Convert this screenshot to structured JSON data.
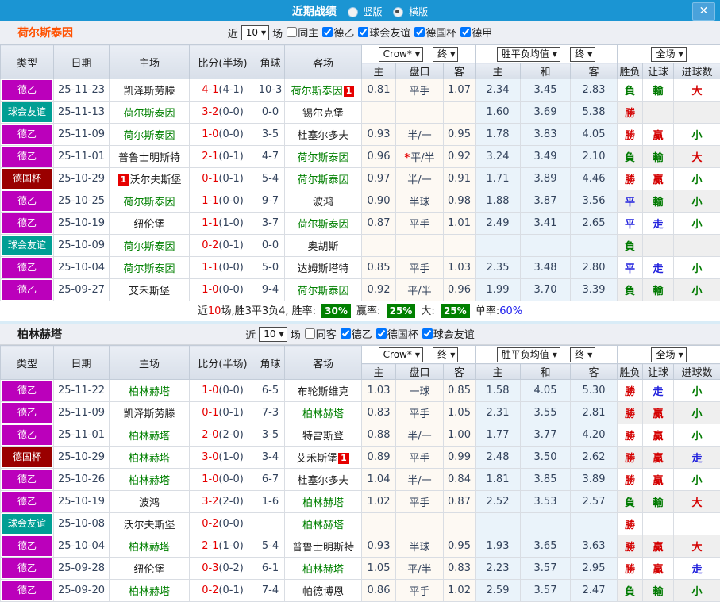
{
  "titlebar": {
    "title": "近期战绩",
    "radios": [
      {
        "label": "竖版",
        "selected": false
      },
      {
        "label": "横版",
        "selected": true
      }
    ],
    "close": "✕"
  },
  "icons": {
    "caret": "▼"
  },
  "colors": {
    "title_bar": "#1b95d3",
    "subject_team": "#008000",
    "league": {
      "德乙": "#bb00bb",
      "球会友谊": "#009e94",
      "德国杯": "#9a0000"
    },
    "result": {
      "勝": "#d40000",
      "負": "#007a00",
      "平": "#2222dd",
      "贏": "#d40000",
      "輸": "#007a00",
      "走": "#2222dd",
      "大": "#d40000",
      "小": "#007a00"
    }
  },
  "table_header": {
    "left_cols": [
      "类型",
      "日期",
      "主场",
      "比分(半场)",
      "角球",
      "客场"
    ],
    "crow_select": "Crow*",
    "final_select": "终",
    "avg_select": "胜平负均值",
    "final_select2": "终",
    "scope_select": "全场",
    "sub_cols": [
      "主",
      "盘口",
      "客",
      "主",
      "和",
      "客",
      "胜负",
      "让球",
      "进球数"
    ]
  },
  "sections": [
    {
      "team": "荷尔斯泰因",
      "team_color": "#ff5100",
      "filters": {
        "near": "近",
        "count": "10",
        "unit": "场",
        "items": [
          {
            "label": "同主",
            "checked": false
          },
          {
            "label": "德乙",
            "checked": true
          },
          {
            "label": "球会友谊",
            "checked": true
          },
          {
            "label": "德国杯",
            "checked": true
          },
          {
            "label": "德甲",
            "checked": true
          }
        ]
      },
      "rows": [
        {
          "league": "德乙",
          "date": "25-11-23",
          "home": {
            "name": "凯泽斯劳滕"
          },
          "score": "4-1",
          "half": "(4-1)",
          "corners": "10-3",
          "away": {
            "name": "荷尔斯泰因",
            "subject": true,
            "badge": "1",
            "badge_pos": "after"
          },
          "crow": [
            "0.81",
            "平手",
            "1.07"
          ],
          "crow_star": false,
          "avg": [
            "2.34",
            "3.45",
            "2.83"
          ],
          "res": [
            "負",
            "輸",
            "大"
          ]
        },
        {
          "league": "球会友谊",
          "date": "25-11-13",
          "home": {
            "name": "荷尔斯泰因",
            "subject": true
          },
          "score": "3-2",
          "half": "(0-0)",
          "corners": "0-0",
          "away": {
            "name": "锡尔克堡"
          },
          "crow": [
            "",
            "",
            ""
          ],
          "crow_star": false,
          "avg": [
            "1.60",
            "3.69",
            "5.38"
          ],
          "res": [
            "勝",
            "",
            ""
          ]
        },
        {
          "league": "德乙",
          "date": "25-11-09",
          "home": {
            "name": "荷尔斯泰因",
            "subject": true
          },
          "score": "1-0",
          "half": "(0-0)",
          "corners": "3-5",
          "away": {
            "name": "杜塞尔多夫"
          },
          "crow": [
            "0.93",
            "半/一",
            "0.95"
          ],
          "crow_star": false,
          "avg": [
            "1.78",
            "3.83",
            "4.05"
          ],
          "res": [
            "勝",
            "贏",
            "小"
          ]
        },
        {
          "league": "德乙",
          "date": "25-11-01",
          "home": {
            "name": "普鲁士明斯特"
          },
          "score": "2-1",
          "half": "(0-1)",
          "corners": "4-7",
          "away": {
            "name": "荷尔斯泰因",
            "subject": true
          },
          "crow": [
            "0.96",
            "平/半",
            "0.92"
          ],
          "crow_star": true,
          "avg": [
            "3.24",
            "3.49",
            "2.10"
          ],
          "res": [
            "負",
            "輸",
            "大"
          ]
        },
        {
          "league": "德国杯",
          "date": "25-10-29",
          "home": {
            "name": "沃尔夫斯堡",
            "badge": "1",
            "badge_pos": "before"
          },
          "score": "0-1",
          "half": "(0-1)",
          "corners": "5-4",
          "away": {
            "name": "荷尔斯泰因",
            "subject": true
          },
          "crow": [
            "0.97",
            "半/一",
            "0.91"
          ],
          "crow_star": false,
          "avg": [
            "1.71",
            "3.89",
            "4.46"
          ],
          "res": [
            "勝",
            "贏",
            "小"
          ]
        },
        {
          "league": "德乙",
          "date": "25-10-25",
          "home": {
            "name": "荷尔斯泰因",
            "subject": true
          },
          "score": "1-1",
          "half": "(0-0)",
          "corners": "9-7",
          "away": {
            "name": "波鸿"
          },
          "crow": [
            "0.90",
            "半球",
            "0.98"
          ],
          "crow_star": false,
          "avg": [
            "1.88",
            "3.87",
            "3.56"
          ],
          "res": [
            "平",
            "輸",
            "小"
          ]
        },
        {
          "league": "德乙",
          "date": "25-10-19",
          "home": {
            "name": "纽伦堡"
          },
          "score": "1-1",
          "half": "(1-0)",
          "corners": "3-7",
          "away": {
            "name": "荷尔斯泰因",
            "subject": true
          },
          "crow": [
            "0.87",
            "平手",
            "1.01"
          ],
          "crow_star": false,
          "avg": [
            "2.49",
            "3.41",
            "2.65"
          ],
          "res": [
            "平",
            "走",
            "小"
          ]
        },
        {
          "league": "球会友谊",
          "date": "25-10-09",
          "home": {
            "name": "荷尔斯泰因",
            "subject": true
          },
          "score": "0-2",
          "half": "(0-1)",
          "corners": "0-0",
          "away": {
            "name": "奥胡斯"
          },
          "crow": [
            "",
            "",
            ""
          ],
          "crow_star": false,
          "avg": [
            "",
            "",
            ""
          ],
          "res": [
            "負",
            "",
            ""
          ]
        },
        {
          "league": "德乙",
          "date": "25-10-04",
          "home": {
            "name": "荷尔斯泰因",
            "subject": true
          },
          "score": "1-1",
          "half": "(0-0)",
          "corners": "5-0",
          "away": {
            "name": "达姆斯塔特"
          },
          "crow": [
            "0.85",
            "平手",
            "1.03"
          ],
          "crow_star": false,
          "avg": [
            "2.35",
            "3.48",
            "2.80"
          ],
          "res": [
            "平",
            "走",
            "小"
          ]
        },
        {
          "league": "德乙",
          "date": "25-09-27",
          "home": {
            "name": "艾禾斯堡"
          },
          "score": "1-0",
          "half": "(0-0)",
          "corners": "9-4",
          "away": {
            "name": "荷尔斯泰因",
            "subject": true
          },
          "crow": [
            "0.92",
            "平/半",
            "0.96"
          ],
          "crow_star": false,
          "avg": [
            "1.99",
            "3.70",
            "3.39"
          ],
          "res": [
            "負",
            "輸",
            "小"
          ]
        }
      ],
      "summary": {
        "near": "近",
        "count": "10",
        "text": "场,胜3平3负4, 胜率: ",
        "win_rate": "30%",
        "mid1": " 赢率: ",
        "handicap_rate": "25%",
        "mid2": " 大: ",
        "big_rate": "25%",
        "mid3": " 单率:",
        "single_rate": "60%"
      }
    },
    {
      "team": "柏林赫塔",
      "team_color": "#1a1a1a",
      "filters": {
        "near": "近",
        "count": "10",
        "unit": "场",
        "items": [
          {
            "label": "同客",
            "checked": false
          },
          {
            "label": "德乙",
            "checked": true
          },
          {
            "label": "德国杯",
            "checked": true
          },
          {
            "label": "球会友谊",
            "checked": true
          }
        ]
      },
      "rows": [
        {
          "league": "德乙",
          "date": "25-11-22",
          "home": {
            "name": "柏林赫塔",
            "subject": true
          },
          "score": "1-0",
          "half": "(0-0)",
          "corners": "6-5",
          "away": {
            "name": "布轮斯维克"
          },
          "crow": [
            "1.03",
            "一球",
            "0.85"
          ],
          "crow_star": false,
          "avg": [
            "1.58",
            "4.05",
            "5.30"
          ],
          "res": [
            "勝",
            "走",
            "小"
          ]
        },
        {
          "league": "德乙",
          "date": "25-11-09",
          "home": {
            "name": "凯泽斯劳滕"
          },
          "score": "0-1",
          "half": "(0-1)",
          "corners": "7-3",
          "away": {
            "name": "柏林赫塔",
            "subject": true
          },
          "crow": [
            "0.83",
            "平手",
            "1.05"
          ],
          "crow_star": false,
          "avg": [
            "2.31",
            "3.55",
            "2.81"
          ],
          "res": [
            "勝",
            "贏",
            "小"
          ]
        },
        {
          "league": "德乙",
          "date": "25-11-01",
          "home": {
            "name": "柏林赫塔",
            "subject": true
          },
          "score": "2-0",
          "half": "(2-0)",
          "corners": "3-5",
          "away": {
            "name": "特雷斯登"
          },
          "crow": [
            "0.88",
            "半/一",
            "1.00"
          ],
          "crow_star": false,
          "avg": [
            "1.77",
            "3.77",
            "4.20"
          ],
          "res": [
            "勝",
            "贏",
            "小"
          ]
        },
        {
          "league": "德国杯",
          "date": "25-10-29",
          "home": {
            "name": "柏林赫塔",
            "subject": true
          },
          "score": "3-0",
          "half": "(1-0)",
          "corners": "3-4",
          "away": {
            "name": "艾禾斯堡",
            "badge": "1",
            "badge_pos": "after"
          },
          "crow": [
            "0.89",
            "平手",
            "0.99"
          ],
          "crow_star": false,
          "avg": [
            "2.48",
            "3.50",
            "2.62"
          ],
          "res": [
            "勝",
            "贏",
            "走"
          ]
        },
        {
          "league": "德乙",
          "date": "25-10-26",
          "home": {
            "name": "柏林赫塔",
            "subject": true
          },
          "score": "1-0",
          "half": "(0-0)",
          "corners": "6-7",
          "away": {
            "name": "杜塞尔多夫"
          },
          "crow": [
            "1.04",
            "半/一",
            "0.84"
          ],
          "crow_star": false,
          "avg": [
            "1.81",
            "3.85",
            "3.89"
          ],
          "res": [
            "勝",
            "贏",
            "小"
          ]
        },
        {
          "league": "德乙",
          "date": "25-10-19",
          "home": {
            "name": "波鸿"
          },
          "score": "3-2",
          "half": "(2-0)",
          "corners": "1-6",
          "away": {
            "name": "柏林赫塔",
            "subject": true
          },
          "crow": [
            "1.02",
            "平手",
            "0.87"
          ],
          "crow_star": false,
          "avg": [
            "2.52",
            "3.53",
            "2.57"
          ],
          "res": [
            "負",
            "輸",
            "大"
          ]
        },
        {
          "league": "球会友谊",
          "date": "25-10-08",
          "home": {
            "name": "沃尔夫斯堡"
          },
          "score": "0-2",
          "half": "(0-0)",
          "corners": "",
          "away": {
            "name": "柏林赫塔",
            "subject": true
          },
          "crow": [
            "",
            "",
            ""
          ],
          "crow_star": false,
          "avg": [
            "",
            "",
            ""
          ],
          "res": [
            "勝",
            "",
            ""
          ]
        },
        {
          "league": "德乙",
          "date": "25-10-04",
          "home": {
            "name": "柏林赫塔",
            "subject": true
          },
          "score": "2-1",
          "half": "(1-0)",
          "corners": "5-4",
          "away": {
            "name": "普鲁士明斯特"
          },
          "crow": [
            "0.93",
            "半球",
            "0.95"
          ],
          "crow_star": false,
          "avg": [
            "1.93",
            "3.65",
            "3.63"
          ],
          "res": [
            "勝",
            "贏",
            "大"
          ]
        },
        {
          "league": "德乙",
          "date": "25-09-28",
          "home": {
            "name": "纽伦堡"
          },
          "score": "0-3",
          "half": "(0-2)",
          "corners": "6-1",
          "away": {
            "name": "柏林赫塔",
            "subject": true
          },
          "crow": [
            "1.05",
            "平/半",
            "0.83"
          ],
          "crow_star": false,
          "avg": [
            "2.23",
            "3.57",
            "2.95"
          ],
          "res": [
            "勝",
            "贏",
            "走"
          ]
        },
        {
          "league": "德乙",
          "date": "25-09-20",
          "home": {
            "name": "柏林赫塔",
            "subject": true
          },
          "score": "0-2",
          "half": "(0-1)",
          "corners": "7-4",
          "away": {
            "name": "帕德博恩"
          },
          "crow": [
            "0.86",
            "平手",
            "1.02"
          ],
          "crow_star": false,
          "avg": [
            "2.59",
            "3.57",
            "2.47"
          ],
          "res": [
            "負",
            "輸",
            "小"
          ]
        }
      ]
    }
  ]
}
